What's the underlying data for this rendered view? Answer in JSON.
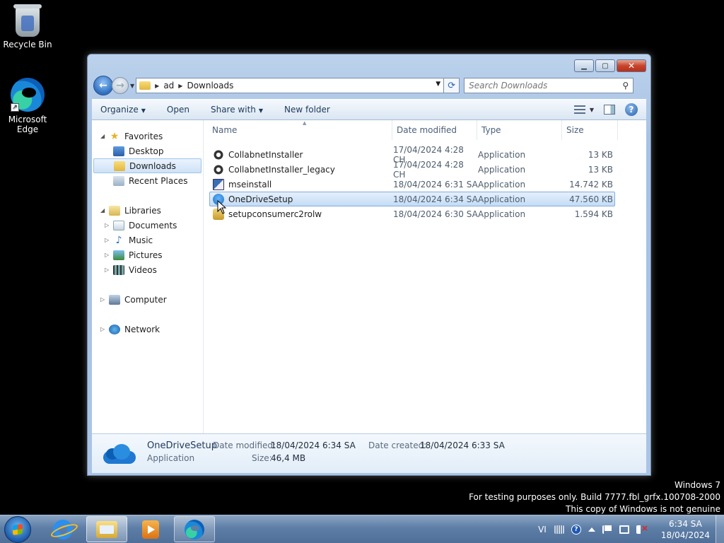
{
  "desktop": {
    "icons": [
      {
        "label": "Recycle Bin",
        "icon": "recycle-bin-icon"
      },
      {
        "label": "Microsoft Edge",
        "icon": "edge-icon"
      }
    ]
  },
  "window": {
    "address": {
      "crumbs": [
        "ad",
        "Downloads"
      ]
    },
    "search_placeholder": "Search Downloads",
    "toolbar": {
      "organize": "Organize",
      "open": "Open",
      "share_with": "Share with",
      "new_folder": "New folder"
    },
    "nav_pane": {
      "favorites": {
        "label": "Favorites",
        "items": [
          "Desktop",
          "Downloads",
          "Recent Places"
        ]
      },
      "libraries": {
        "label": "Libraries",
        "items": [
          "Documents",
          "Music",
          "Pictures",
          "Videos"
        ]
      },
      "computer": "Computer",
      "network": "Network"
    },
    "columns": [
      "Name",
      "Date modified",
      "Type",
      "Size"
    ],
    "files": [
      {
        "name": "CollabnetInstaller",
        "date": "17/04/2024 4:28 CH",
        "type": "Application",
        "size": "13 KB",
        "icon": "gear-icon"
      },
      {
        "name": "CollabnetInstaller_legacy",
        "date": "17/04/2024 4:28 CH",
        "type": "Application",
        "size": "13 KB",
        "icon": "gear-icon"
      },
      {
        "name": "mseinstall",
        "date": "18/04/2024 6:31 SA",
        "type": "Application",
        "size": "14.742 KB",
        "icon": "installer-icon"
      },
      {
        "name": "OneDriveSetup",
        "date": "18/04/2024 6:34 SA",
        "type": "Application",
        "size": "47.560 KB",
        "icon": "onedrive-icon",
        "selected": true
      },
      {
        "name": "setupconsumerc2rolw",
        "date": "18/04/2024 6:30 SA",
        "type": "Application",
        "size": "1.594 KB",
        "icon": "setup-icon"
      }
    ],
    "details": {
      "name": "OneDriveSetup",
      "type": "Application",
      "date_modified_label": "Date modified:",
      "date_modified": "18/04/2024 6:34 SA",
      "date_created_label": "Date created:",
      "date_created": "18/04/2024 6:33 SA",
      "size_label": "Size:",
      "size": "46,4 MB"
    }
  },
  "watermark": {
    "line1": "Windows 7",
    "line2": "For testing purposes only. Build 7777.fbl_grfx.100708-2000",
    "line3": "This copy of Windows is not genuine"
  },
  "taskbar": {
    "language": "VI",
    "time": "6:34 SA",
    "date": "18/04/2024"
  }
}
